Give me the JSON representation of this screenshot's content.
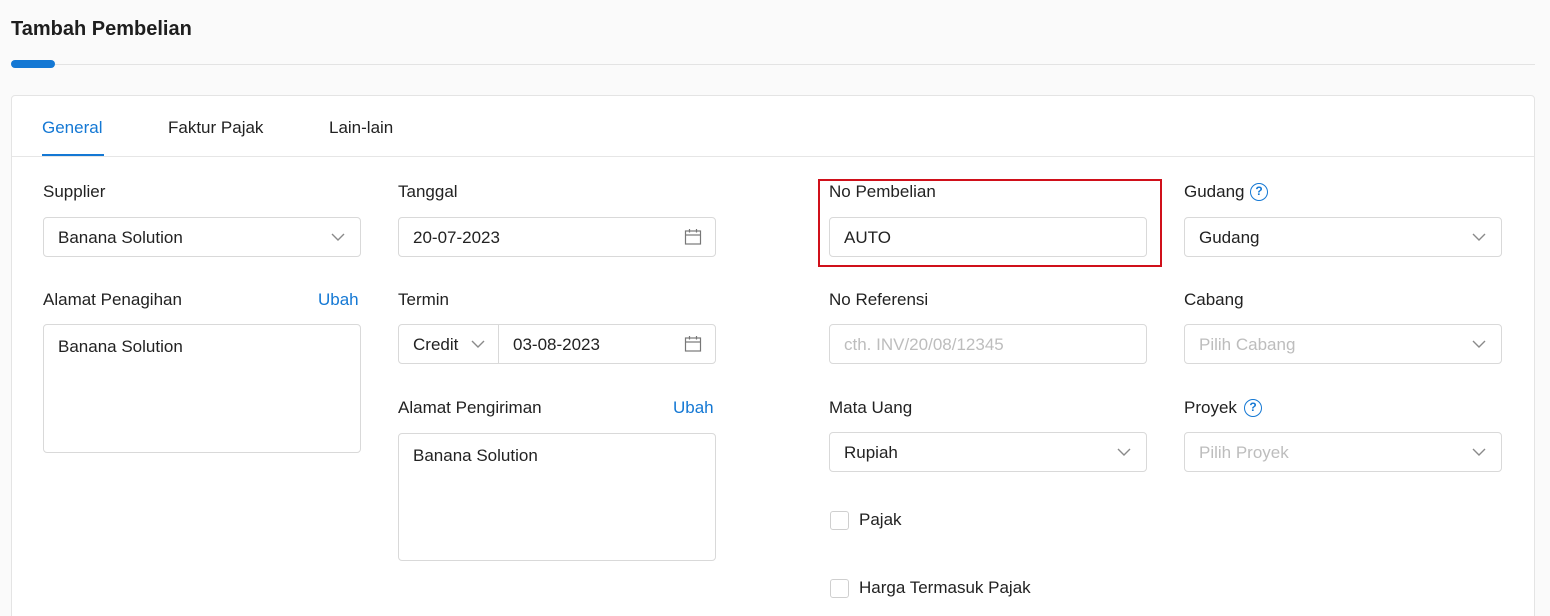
{
  "page": {
    "title": "Tambah Pembelian"
  },
  "tabs": [
    {
      "label": "General",
      "active": true
    },
    {
      "label": "Faktur Pajak",
      "active": false
    },
    {
      "label": "Lain-lain",
      "active": false
    }
  ],
  "form": {
    "supplier": {
      "label": "Supplier",
      "value": "Banana Solution"
    },
    "alamat_penagihan": {
      "label": "Alamat Penagihan",
      "action": "Ubah",
      "value": "Banana Solution"
    },
    "tanggal": {
      "label": "Tanggal",
      "value": "20-07-2023"
    },
    "termin": {
      "label": "Termin",
      "type_value": "Credit",
      "date_value": "03-08-2023"
    },
    "alamat_pengiriman": {
      "label": "Alamat Pengiriman",
      "action": "Ubah",
      "value": "Banana Solution"
    },
    "no_pembelian": {
      "label": "No Pembelian",
      "value": "AUTO"
    },
    "no_referensi": {
      "label": "No Referensi",
      "placeholder": "cth. INV/20/08/12345"
    },
    "mata_uang": {
      "label": "Mata Uang",
      "value": "Rupiah"
    },
    "pajak": {
      "label": "Pajak",
      "checked": false
    },
    "harga_termasuk_pajak": {
      "label": "Harga Termasuk Pajak",
      "checked": false
    },
    "gudang": {
      "label": "Gudang",
      "value": "Gudang",
      "help": "?"
    },
    "cabang": {
      "label": "Cabang",
      "placeholder": "Pilih Cabang"
    },
    "proyek": {
      "label": "Proyek",
      "placeholder": "Pilih Proyek",
      "help": "?"
    }
  },
  "colors": {
    "accent": "#1478d4",
    "highlight": "#d0101a"
  },
  "icons": {
    "dropdown": "chevron-down-icon",
    "date": "calendar-icon",
    "help": "help-circle-icon"
  }
}
